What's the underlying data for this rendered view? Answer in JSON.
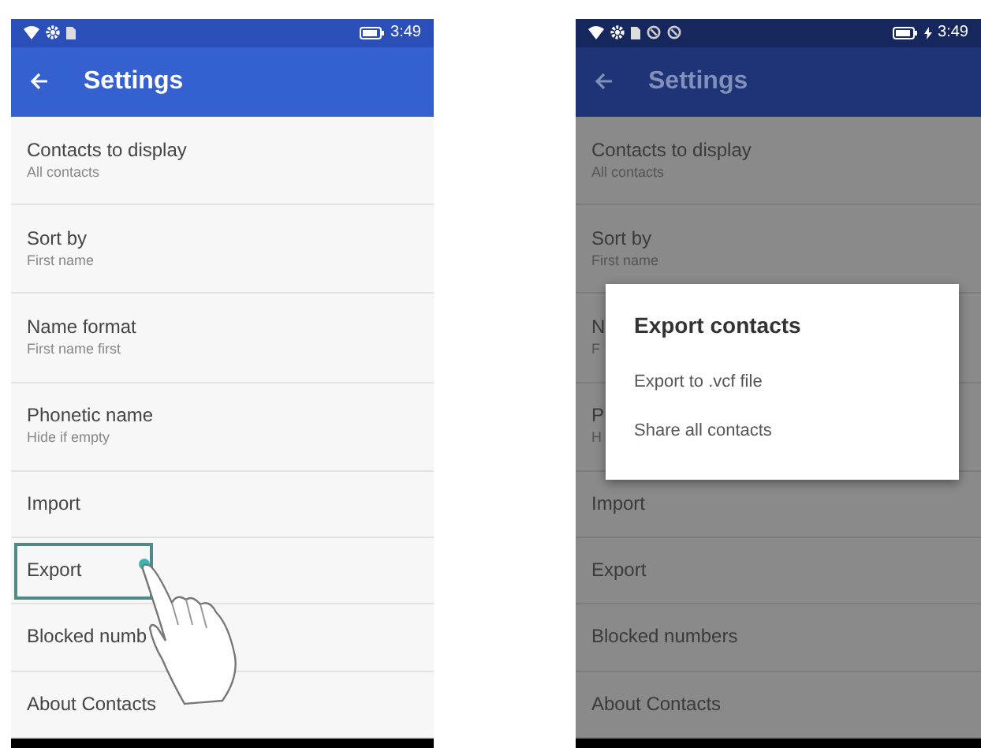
{
  "screens": [
    {
      "dimmed": false,
      "status_bar": {
        "icons": [
          {
            "kind": "wifi"
          },
          {
            "kind": "gear"
          },
          {
            "kind": "sim"
          }
        ],
        "charging": false,
        "time": "3:49"
      },
      "app_bar": {
        "title": "Settings"
      },
      "items": [
        {
          "title": "Contacts to display",
          "subtitle": "All contacts",
          "selected": false
        },
        {
          "title": "Sort by",
          "subtitle": "First name",
          "selected": false
        },
        {
          "title": "Name format",
          "subtitle": "First name first",
          "selected": false
        },
        {
          "title": "Phonetic name",
          "subtitle": "Hide if empty",
          "selected": false
        },
        {
          "title": "Import",
          "selected": false
        },
        {
          "title": "Export",
          "selected": true
        },
        {
          "title": "Blocked numb",
          "selected": false
        },
        {
          "title": "About Contacts",
          "selected": false
        }
      ]
    },
    {
      "dimmed": true,
      "status_bar": {
        "icons": [
          {
            "kind": "wifi"
          },
          {
            "kind": "gear"
          },
          {
            "kind": "sim"
          },
          {
            "kind": "ring"
          },
          {
            "kind": "ring"
          }
        ],
        "charging": true,
        "time": "3:49"
      },
      "app_bar": {
        "title": "Settings"
      },
      "items": [
        {
          "title": "Contacts to display",
          "subtitle": "All contacts",
          "selected": false
        },
        {
          "title": "Sort by",
          "subtitle": "First name",
          "selected": false
        },
        {
          "title": "N",
          "subtitle": "F",
          "selected": false
        },
        {
          "title": "P",
          "subtitle": "H",
          "selected": false
        },
        {
          "title": "Import",
          "selected": false
        },
        {
          "title": "Export",
          "selected": false
        },
        {
          "title": "Blocked numbers",
          "selected": false
        },
        {
          "title": "About Contacts",
          "selected": false
        }
      ],
      "dialog": {
        "title": "Export contacts",
        "options": [
          "Export to .vcf file",
          "Share all contacts"
        ]
      }
    }
  ]
}
